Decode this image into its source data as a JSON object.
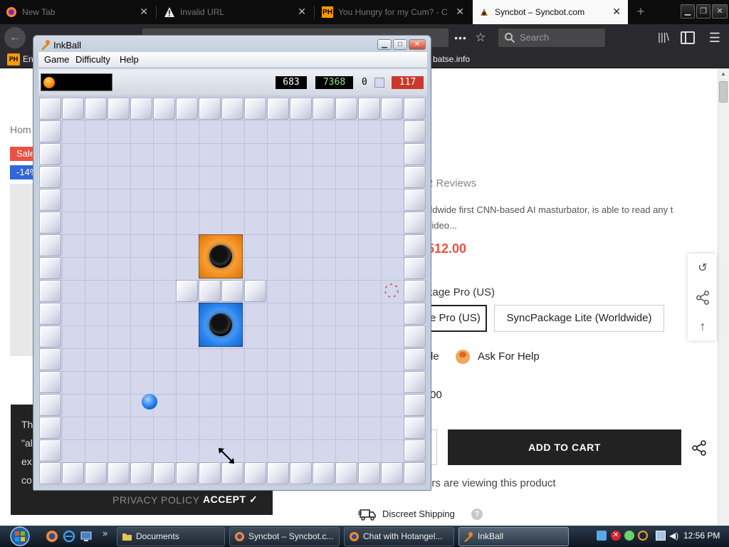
{
  "browser": {
    "tabs": [
      {
        "label": "New Tab",
        "favicon": "firefox-icon",
        "active": false
      },
      {
        "label": "Invalid URL",
        "favicon": "warning-icon",
        "active": false
      },
      {
        "label": "You Hungry for my Cum? - C",
        "favicon": "ph-icon",
        "favicon_text": "PH",
        "active": false
      },
      {
        "label": "Syncbot – Syncbot.com",
        "favicon": "syncbot-icon",
        "active": true
      }
    ],
    "new_tab_label": "+",
    "search_placeholder": "Search",
    "bookmarks": {
      "item1_favicon_text": "PH",
      "item1_label": "En",
      "item2_label": "batse.info"
    }
  },
  "page": {
    "breadcrumb": "Hom",
    "sale_badge": "Sale",
    "discount_badge": "-14%",
    "reviews": "2 Reviews",
    "description": "rldwide first CNN-based AI masturbator, is able to read any t video...",
    "price": "512.00",
    "package_label": "kage Pro (US)",
    "option_selected": "e Pro (US)",
    "option_other": "SyncPackage Lite (Worldwide)",
    "guide_fragment": "de",
    "help_label": "Ask For Help",
    "total": ".00",
    "add_to_cart": "ADD TO CART",
    "viewers": "ers are viewing this product",
    "shipping": "Discreet Shipping",
    "shipping_help": "?",
    "cookie": {
      "text_lines": [
        "Th",
        "\"al",
        "ex",
        "co"
      ],
      "privacy": "PRIVACY POLICY",
      "accept": "ACCEPT ✓"
    },
    "floating": {
      "recent_icon": "history-icon",
      "share_icon": "share-icon",
      "top_icon": "arrow-up-icon"
    }
  },
  "inkball": {
    "title": "InkBall",
    "menu": [
      "Game",
      "Difficulty",
      "Help"
    ],
    "score": "683",
    "high_score": "7368",
    "count": "0",
    "timer": "117",
    "colors": {
      "orange": "#f29020",
      "blue": "#2a84ef",
      "timer_bg": "#c8392b",
      "floor": "#d5d7ec"
    }
  },
  "taskbar": {
    "buttons": [
      {
        "label": "Documents",
        "icon": "folder-icon",
        "active": false
      },
      {
        "label": "Syncbot – Syncbot.c...",
        "icon": "firefox-icon",
        "active": false
      },
      {
        "label": "Chat with Hotangel...",
        "icon": "firefox-icon",
        "active": false
      },
      {
        "label": "InkBall",
        "icon": "inkball-icon",
        "active": true
      }
    ],
    "clock": "12:56 PM"
  }
}
